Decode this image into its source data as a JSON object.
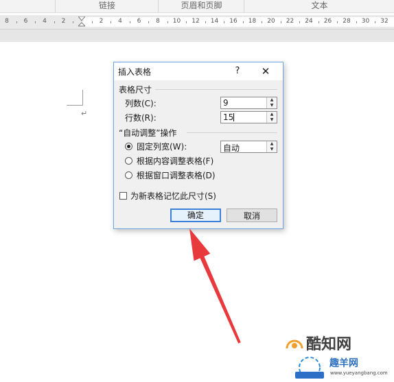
{
  "ribbon": {
    "groups": [
      "链接",
      "页眉和页脚",
      "文本"
    ]
  },
  "ruler": {
    "labels": [
      "8",
      "6",
      "4",
      "2",
      "2",
      "4",
      "6",
      "8",
      "10",
      "12",
      "14",
      "16",
      "18",
      "20",
      "22",
      "24",
      "26",
      "28",
      "30",
      "32"
    ]
  },
  "document": {
    "paragraph_mark": "↵"
  },
  "dialog": {
    "title": "插入表格",
    "help_label": "?",
    "close_label": "✕",
    "table_size": {
      "heading": "表格尺寸",
      "columns_label": "列数(C):",
      "columns_value": "9",
      "rows_label": "行数(R):",
      "rows_value": "15"
    },
    "autofit": {
      "heading": "“自动调整”操作",
      "fixed_label": "固定列宽(W):",
      "fixed_value": "自动",
      "content_label": "根据内容调整表格(F)",
      "window_label": "根据窗口调整表格(D)",
      "selected": "fixed"
    },
    "remember_label": "为新表格记忆此尺寸(S)",
    "remember_checked": false,
    "ok_label": "确定",
    "cancel_label": "取消"
  },
  "watermark": {
    "logo_text": "酷知网",
    "brand_text": "趣羊网",
    "url_text": "www.yueyangbang.com"
  },
  "colors": {
    "arrow": "#e8393c",
    "dialog_border": "#6aa5e0",
    "default_button_border": "#3c7fd6"
  }
}
